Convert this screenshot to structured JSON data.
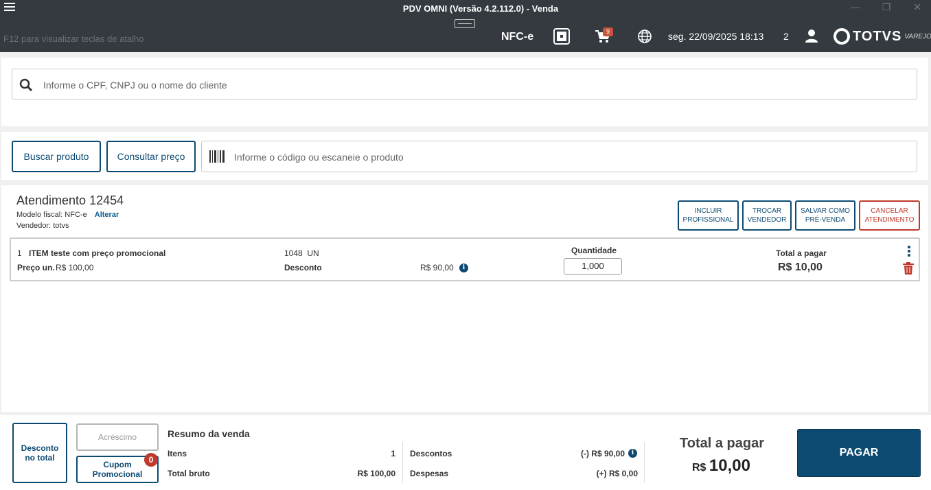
{
  "window": {
    "title": "PDV OMNI (Versão 4.2.112.0) - Venda",
    "minimize": "—",
    "maximize": "❐",
    "close": "✕"
  },
  "header": {
    "shortcut_hint": "F12 para visualizar teclas de atalho",
    "fiscal_mode": "NFC-e",
    "cart_count": "9",
    "datetime": "seg. 22/09/2025 18:13",
    "user_count": "2",
    "brand_name": "TOTVS",
    "brand_sub": "VAREJO"
  },
  "client": {
    "placeholder": "Informe o CPF, CNPJ ou o nome do cliente"
  },
  "product": {
    "search_button": "Buscar produto",
    "price_button": "Consultar preço",
    "placeholder": "Informe o código ou escaneie o produto"
  },
  "attendance": {
    "title": "Atendimento 12454",
    "fiscal_model_label": "Modelo fiscal: NFC-e",
    "change_link": "Alterar",
    "seller_label": "Vendedor: totvs",
    "actions": [
      {
        "line1": "INCLUIR",
        "line2": "PROFISSIONAL"
      },
      {
        "line1": "TROCAR",
        "line2": "VENDEDOR"
      },
      {
        "line1": "SALVAR COMO",
        "line2": "PRÉ-VENDA"
      },
      {
        "line1": "CANCELAR",
        "line2": "ATENDIMENTO"
      }
    ]
  },
  "items": [
    {
      "index": "1",
      "name": "ITEM teste com preço promocional",
      "code_unit": "1048  UN",
      "unit_price_label": "Preço un.",
      "unit_price": "R$ 100,00",
      "discount_label": "Desconto",
      "discount_value": "R$ 90,00",
      "quantity_label": "Quantidade",
      "quantity": "1,000",
      "total_label": "Total a pagar",
      "total_value": "R$ 10,00"
    }
  ],
  "footer": {
    "discount_total_l1": "Desconto",
    "discount_total_l2": "no total",
    "surcharge": "Acréscimo",
    "promo_coupon": "Cupom Promocional",
    "promo_badge": "0",
    "summary_title": "Resumo da venda",
    "items_label": "Itens",
    "items_value": "1",
    "gross_label": "Total bruto",
    "gross_value": "R$ 100,00",
    "discounts_label": "Descontos",
    "discounts_value": "(-) R$ 90,00",
    "expenses_label": "Despesas",
    "expenses_value": "(+) R$ 0,00",
    "total_label": "Total a pagar",
    "total_currency": "R$",
    "total_value": "10,00",
    "pay_button": "PAGAR"
  },
  "colors": {
    "header_bg": "#343a40",
    "primary": "#0c4a72",
    "danger": "#c0392b",
    "badge": "#c8553d"
  }
}
